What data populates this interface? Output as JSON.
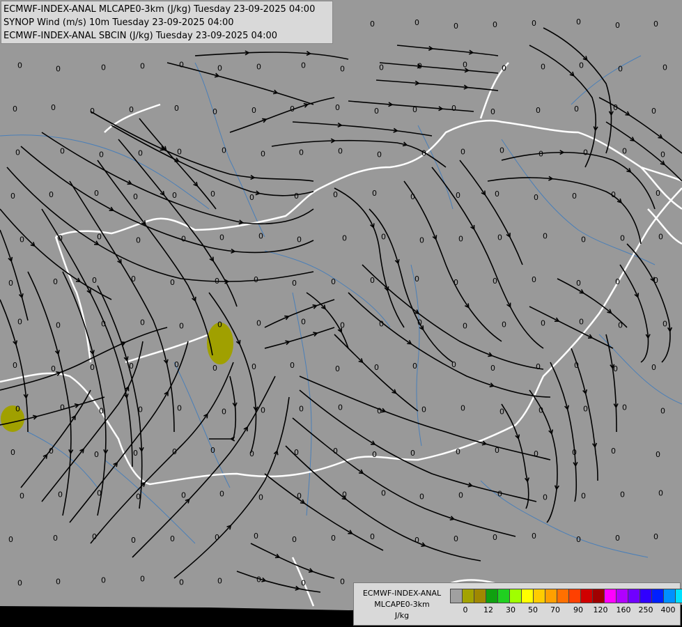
{
  "header": {
    "line1": "ECMWF-INDEX-ANAL MLCAPE0-3km (J/kg) Tuesday 23-09-2025 04:00",
    "line2": "SYNOP Wind (m/s) 10m Tuesday 23-09-2025 04:00",
    "line3": "ECMWF-INDEX-ANAL SBCIN (J/kg) Tuesday 23-09-2025 04:00"
  },
  "legend": {
    "title1": "ECMWF-INDEX-ANAL",
    "title2": "MLCAPE0-3km",
    "unit": "J/kg",
    "ticks": [
      "0",
      "12",
      "30",
      "50",
      "70",
      "90",
      "120",
      "160",
      "250",
      "400"
    ],
    "colors": [
      "#a0a0a0",
      "#a3a300",
      "#a08800",
      "#10a010",
      "#20d020",
      "#a0ff00",
      "#ffff00",
      "#ffcc00",
      "#ffa000",
      "#ff7000",
      "#ff4000",
      "#d00000",
      "#a00000",
      "#ff00ff",
      "#b000ff",
      "#7000ff",
      "#3000ff",
      "#0020ff",
      "#0090ff",
      "#00e0ff",
      "#80ffff",
      "#ffffff"
    ]
  },
  "map": {
    "background": "#999999",
    "border_color": "#ffffff",
    "river_color": "#4a7fb8",
    "streamline_color": "#000000",
    "cape_color": "#a0a000",
    "value_label": "0"
  }
}
